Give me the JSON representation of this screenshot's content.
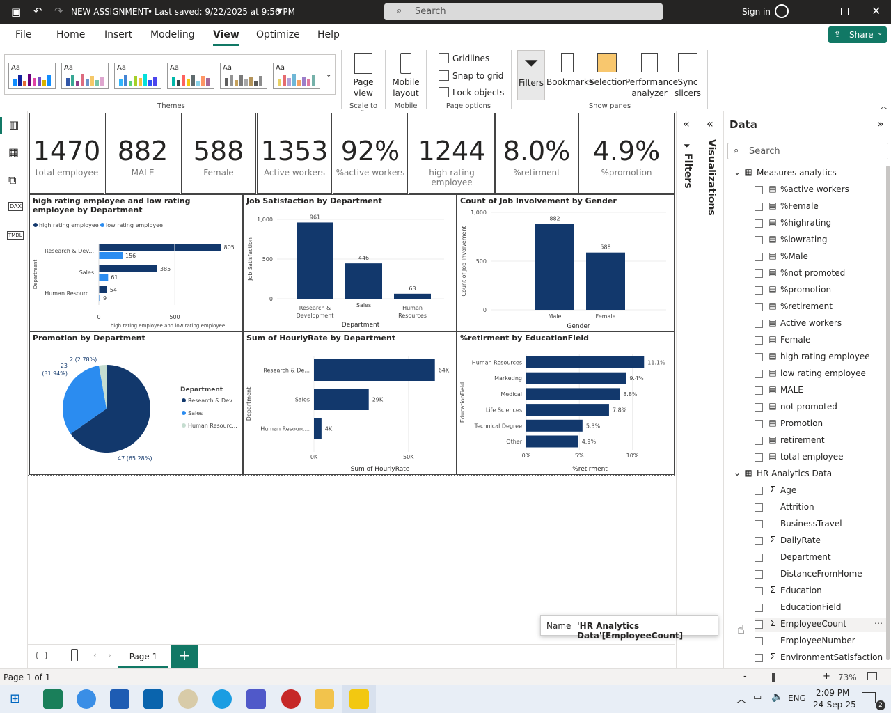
{
  "app": {
    "title": "NEW ASSIGNMENT",
    "saved": "Last saved: 9/22/2025 at 9:56 PM",
    "search_placeholder": "Search",
    "signin": "Sign in"
  },
  "menu": [
    "File",
    "Home",
    "Insert",
    "Modeling",
    "View",
    "Optimize",
    "Help"
  ],
  "share_label": "Share",
  "ribbon": {
    "themes_label": "Themes",
    "page_view": "Page view",
    "scale_to_fit": "Scale to fit",
    "mobile_layout": "Mobile layout",
    "mobile": "Mobile",
    "gridlines": "Gridlines",
    "snap_to_grid": "Snap to grid",
    "lock_objects": "Lock objects",
    "page_options": "Page options",
    "filters": "Filters",
    "bookmarks": "Bookmarks",
    "selection": "Selection",
    "performance_analyzer": "Performance analyzer",
    "sync_slicers": "Sync slicers",
    "show_panes": "Show panes"
  },
  "cards": [
    {
      "value": "1470",
      "label": "total employee"
    },
    {
      "value": "882",
      "label": "MALE"
    },
    {
      "value": "588",
      "label": "Female"
    },
    {
      "value": "1353",
      "label": "Active workers"
    },
    {
      "value": "92%",
      "label": "%active workers"
    },
    {
      "value": "1244",
      "label": "high rating employee"
    },
    {
      "value": "8.0%",
      "label": "%retirment"
    },
    {
      "value": "4.9%",
      "label": "%promotion"
    }
  ],
  "chart_data": [
    {
      "type": "bar",
      "orientation": "horizontal",
      "title": "high rating employee and low rating employee by Department",
      "categories": [
        "Research & Dev...",
        "Sales",
        "Human Resourc..."
      ],
      "series": [
        {
          "name": "high rating employee",
          "values": [
            805,
            385,
            54
          ]
        },
        {
          "name": "low rating employee",
          "values": [
            156,
            61,
            9
          ]
        }
      ],
      "xlabel": "high rating employee and low rating employee",
      "ylabel": "Department",
      "xticks": [
        "0",
        "500"
      ],
      "xlim": [
        0,
        900
      ],
      "legend": "top-left"
    },
    {
      "type": "bar",
      "title": "Job Satisfaction by Department",
      "categories": [
        "Research & Development",
        "Sales",
        "Human Resources"
      ],
      "values": [
        961,
        446,
        63
      ],
      "xlabel": "Department",
      "ylabel": "Job Satisfaction",
      "yticks": [
        "0",
        "500",
        "1,000"
      ],
      "ylim": [
        0,
        1000
      ]
    },
    {
      "type": "bar",
      "title": "Count of Job Involvement by Gender",
      "categories": [
        "Male",
        "Female"
      ],
      "values": [
        882,
        588
      ],
      "xlabel": "Gender",
      "ylabel": "Count of Job Involvement",
      "yticks": [
        "0",
        "500",
        "1,000"
      ],
      "ylim": [
        0,
        1000
      ]
    },
    {
      "type": "pie",
      "title": "Promotion by Department",
      "legend_title": "Department",
      "categories": [
        "Research & Dev...",
        "Sales",
        "Human Resourc..."
      ],
      "values": [
        47,
        23,
        2
      ],
      "labels": [
        "47 (65.28%)",
        "23 (31.94%)",
        "2 (2.78%)"
      ],
      "legend": "right"
    },
    {
      "type": "bar",
      "orientation": "horizontal",
      "title": "Sum of HourlyRate by Department",
      "categories": [
        "Research & De...",
        "Sales",
        "Human Resourc..."
      ],
      "values": [
        64,
        29,
        4
      ],
      "value_labels": [
        "64K",
        "29K",
        "4K"
      ],
      "xlabel": "Sum of HourlyRate",
      "ylabel": "Department",
      "xticks": [
        "0K",
        "50K"
      ],
      "xlim": [
        0,
        70
      ]
    },
    {
      "type": "bar",
      "orientation": "horizontal",
      "title": "%retirment by EducationField",
      "categories": [
        "Human Resources",
        "Marketing",
        "Medical",
        "Life Sciences",
        "Technical Degree",
        "Other"
      ],
      "values": [
        11.1,
        9.4,
        8.8,
        7.8,
        5.3,
        4.9
      ],
      "value_labels": [
        "11.1%",
        "9.4%",
        "8.8%",
        "7.8%",
        "5.3%",
        "4.9%"
      ],
      "xlabel": "%retirment",
      "ylabel": "EducationField",
      "xticks": [
        "0%",
        "5%",
        "10%"
      ],
      "xlim": [
        0,
        12
      ]
    }
  ],
  "colors": {
    "dark_blue": "#12386c",
    "light_blue": "#2b8cf0",
    "pale": "#c5ddd0",
    "accent_green": "#117865"
  },
  "panes": {
    "filters": "Filters",
    "visualizations": "Visualizations",
    "data": "Data",
    "search_placeholder": "Search"
  },
  "data_tables": [
    {
      "name": "Measures analytics",
      "fields": [
        "%active workers",
        "%Female",
        "%highrating",
        "%lowrating",
        "%Male",
        "%not promoted",
        "%promotion",
        "%retirement",
        "Active workers",
        "Female",
        "high rating employee",
        "low rating employee",
        "MALE",
        "not promoted",
        "Promotion",
        "retirement",
        "total employee"
      ]
    },
    {
      "name": "HR Analytics Data",
      "fields": [
        {
          "n": "Age",
          "s": true
        },
        {
          "n": "Attrition",
          "s": false
        },
        {
          "n": "BusinessTravel",
          "s": false
        },
        {
          "n": "DailyRate",
          "s": true
        },
        {
          "n": "Department",
          "s": false
        },
        {
          "n": "DistanceFromHome",
          "s": false
        },
        {
          "n": "Education",
          "s": true
        },
        {
          "n": "EducationField",
          "s": false
        },
        {
          "n": "EmployeeCount",
          "s": true
        },
        {
          "n": "EmployeeNumber",
          "s": false
        },
        {
          "n": "EnvironmentSatisfaction",
          "s": true
        }
      ]
    }
  ],
  "tooltip": {
    "key": "Name",
    "value": "'HR Analytics Data'[EmployeeCount]"
  },
  "page_tab": "Page 1",
  "status": {
    "page": "Page 1 of 1",
    "zoom": "73%"
  },
  "taskbar": {
    "lang": "ENG",
    "time": "2:09 PM",
    "date": "24-Sep-25",
    "notif": "2"
  }
}
